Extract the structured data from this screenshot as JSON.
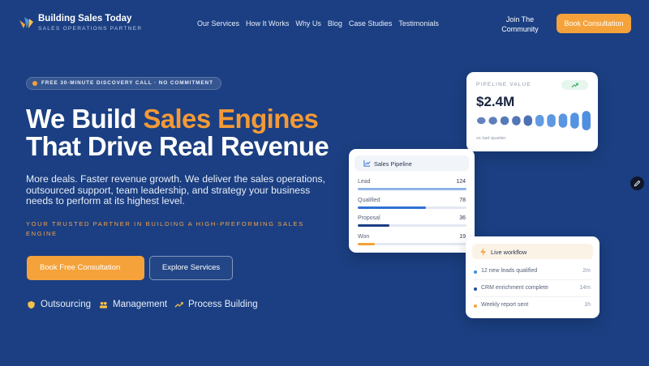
{
  "brand": {
    "name": "Building Sales Today",
    "tagline": "SALES OPERATIONS PARTNER",
    "accent": "#f5a23a",
    "background": "#1b3f82"
  },
  "nav": [
    "Our Services",
    "How It Works",
    "Why Us",
    "Blog",
    "Case Studies",
    "Testimonials"
  ],
  "header": {
    "join_label_line1": "Join The",
    "join_label_line2": "Community",
    "cta_label": "Book Consultation"
  },
  "hero": {
    "badge": "FREE 30-MINUTE DISCOVERY CALL · NO COMMITMENT",
    "headline_line1_plain": "We Build ",
    "headline_line1_accent": "Sales Engines",
    "headline_line2": "That Drive Real Revenue",
    "lede": "More deals. Faster revenue growth. We deliver the sales operations, outsourced support, team leadership, and strategy your business needs to perform at its highest level.",
    "tagline": "YOUR TRUSTED PARTNER IN BUILDING A HIGH-PREFORMING SALES ENGINE",
    "primary_cta": "Book Free Consultation",
    "secondary_cta": "Explore Services",
    "features": [
      {
        "icon": "shield-icon",
        "label": "Outsourcing"
      },
      {
        "icon": "team-icon",
        "label": "Management"
      },
      {
        "icon": "trend-icon",
        "label": "Process Building"
      }
    ]
  },
  "pipeline_value": {
    "label": "PIPELINE VALUE",
    "value": "$2.4M",
    "note": "vs last quarter",
    "trend_icon": "trend-up-icon",
    "bars": [
      0.35,
      0.4,
      0.45,
      0.48,
      0.55,
      0.6,
      0.67,
      0.73,
      0.82,
      1.0
    ]
  },
  "sales_pipeline": {
    "title": "Sales Pipeline",
    "max": 124,
    "rows": [
      {
        "label": "Lead",
        "value": 124,
        "color": "#8fb4e8"
      },
      {
        "label": "Qualified",
        "value": 78,
        "color": "#2f6fd1"
      },
      {
        "label": "Proposal",
        "value": 36,
        "color": "#1c3f86"
      },
      {
        "label": "Won",
        "value": 19,
        "color": "#f5a23a"
      }
    ]
  },
  "live_workflow": {
    "title": "Live workflow",
    "items": [
      {
        "text": "12 new leads qualified",
        "time": "2m",
        "color": "#3b8fd9"
      },
      {
        "text": "CRM enrichment complete",
        "time": "14m",
        "color": "#1f4f9e"
      },
      {
        "text": "Weekly report sent",
        "time": "1h",
        "color": "#f5a23a"
      }
    ]
  }
}
